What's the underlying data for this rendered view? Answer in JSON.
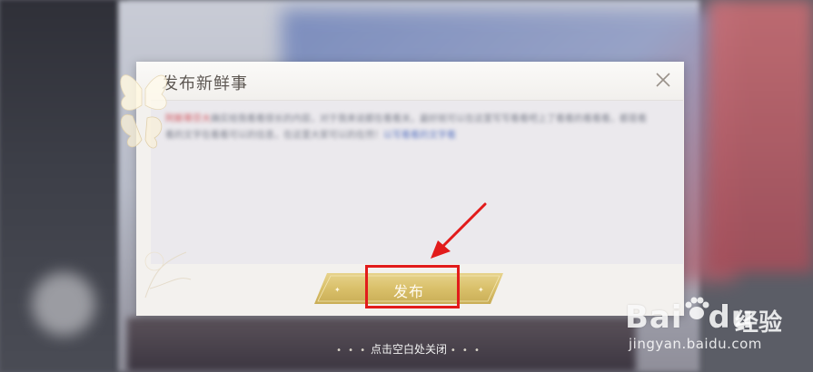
{
  "dialog": {
    "title": "发布新鲜事",
    "close_icon": "close-icon",
    "content": {
      "blurred": true,
      "highlight": "阿斯蒂芬大",
      "body": "确实给我看看很长的内容，对于我来说都在看看关，最好就可以在这里写写看看吧上了看看的看看看，都是看看的文字在看看可以的信息，在这里大家可以的在然！",
      "link": "以写看看的文字看"
    },
    "publish_button": {
      "label": "发布"
    }
  },
  "close_hint": {
    "label": "点击空白处关闭",
    "left_dots": "• • •",
    "right_dots": "• • •"
  },
  "annotation": {
    "highlight_color": "#e21b1b",
    "arrow_color": "#e21b1b"
  },
  "watermark": {
    "brand": "Bai",
    "brand_tail": "du",
    "jingyan": "经验",
    "url": "jingyan.baidu.com"
  }
}
